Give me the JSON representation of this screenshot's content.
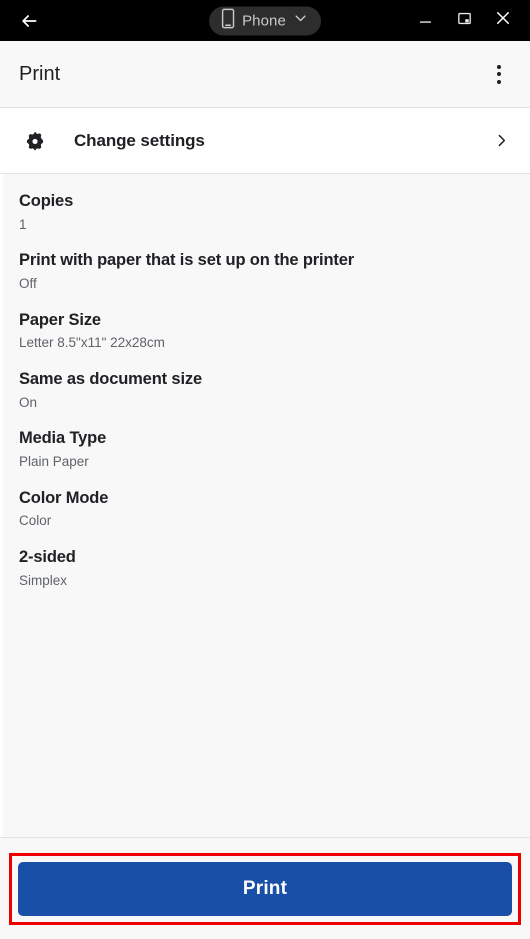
{
  "window": {
    "back_icon": "back-arrow-icon",
    "device_pill": {
      "icon": "phone-icon",
      "label": "Phone",
      "chevron": "chevron-down-icon"
    },
    "controls": {
      "minimize": "minimize-icon",
      "restore": "restore-window-icon",
      "close": "close-icon"
    }
  },
  "header": {
    "title": "Print",
    "overflow_icon": "more-vertical-icon"
  },
  "change_settings": {
    "icon": "gear-icon",
    "label": "Change settings",
    "chevron": "chevron-right-icon"
  },
  "settings": [
    {
      "name": "Copies",
      "value": "1"
    },
    {
      "name": "Print with paper that is set up on the printer",
      "value": "Off"
    },
    {
      "name": "Paper Size",
      "value": "Letter 8.5\"x11\" 22x28cm"
    },
    {
      "name": "Same as document size",
      "value": "On"
    },
    {
      "name": "Media Type",
      "value": "Plain Paper"
    },
    {
      "name": "Color Mode",
      "value": "Color"
    },
    {
      "name": "2-sided",
      "value": "Simplex"
    }
  ],
  "footer": {
    "print_label": "Print"
  },
  "colors": {
    "titlebar_bg": "#000000",
    "pill_bg": "#2d2d2d",
    "page_bg": "#f8f8f9",
    "row_bg": "#ffffff",
    "divider": "#e2e3e5",
    "text_primary": "#202124",
    "text_secondary": "#5f6368",
    "primary_button": "#1a4fa8",
    "highlight_border": "#ee0000"
  }
}
